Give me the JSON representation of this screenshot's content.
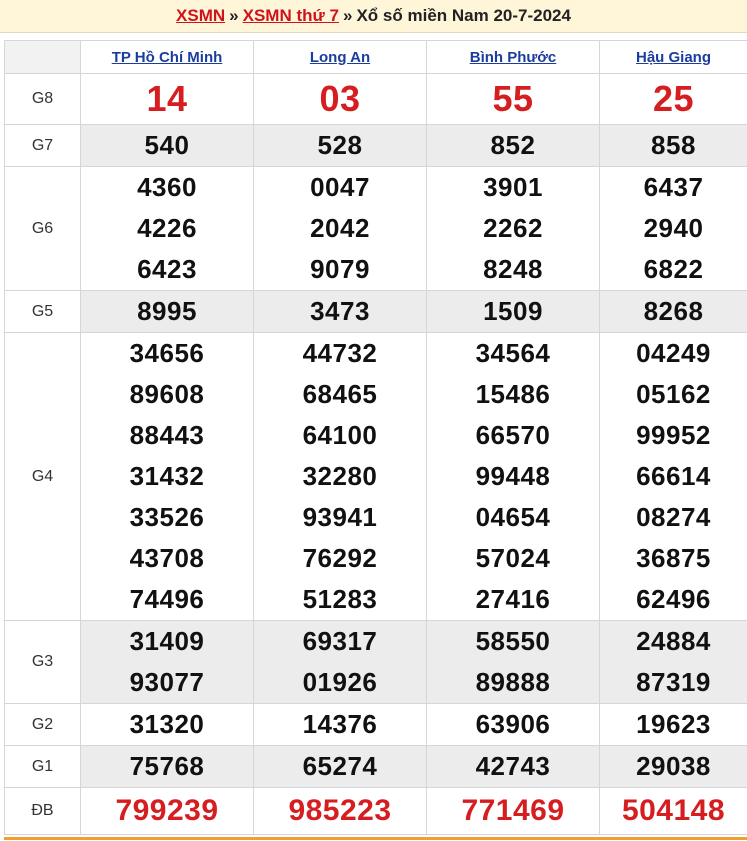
{
  "breadcrumb": {
    "home": "XSMN",
    "section": "XSMN thứ 7",
    "separator": "»",
    "current": "Xổ số miền Nam 20-7-2024"
  },
  "provinces": [
    "TP Hồ Chí Minh",
    "Long An",
    "Bình Phước",
    "Hậu Giang"
  ],
  "prizes": [
    {
      "label": "G8",
      "style": "big",
      "values": [
        [
          "14"
        ],
        [
          "03"
        ],
        [
          "55"
        ],
        [
          "25"
        ]
      ]
    },
    {
      "label": "G7",
      "style": "normal",
      "values": [
        [
          "540"
        ],
        [
          "528"
        ],
        [
          "852"
        ],
        [
          "858"
        ]
      ]
    },
    {
      "label": "G6",
      "style": "normal",
      "values": [
        [
          "4360",
          "4226",
          "6423"
        ],
        [
          "0047",
          "2042",
          "9079"
        ],
        [
          "3901",
          "2262",
          "8248"
        ],
        [
          "6437",
          "2940",
          "6822"
        ]
      ]
    },
    {
      "label": "G5",
      "style": "normal",
      "values": [
        [
          "8995"
        ],
        [
          "3473"
        ],
        [
          "1509"
        ],
        [
          "8268"
        ]
      ]
    },
    {
      "label": "G4",
      "style": "normal",
      "values": [
        [
          "34656",
          "89608",
          "88443",
          "31432",
          "33526",
          "43708",
          "74496"
        ],
        [
          "44732",
          "68465",
          "64100",
          "32280",
          "93941",
          "76292",
          "51283"
        ],
        [
          "34564",
          "15486",
          "66570",
          "99448",
          "04654",
          "57024",
          "27416"
        ],
        [
          "04249",
          "05162",
          "99952",
          "66614",
          "08274",
          "36875",
          "62496"
        ]
      ]
    },
    {
      "label": "G3",
      "style": "normal",
      "values": [
        [
          "31409",
          "93077"
        ],
        [
          "69317",
          "01926"
        ],
        [
          "58550",
          "89888"
        ],
        [
          "24884",
          "87319"
        ]
      ]
    },
    {
      "label": "G2",
      "style": "normal",
      "values": [
        [
          "31320"
        ],
        [
          "14376"
        ],
        [
          "63906"
        ],
        [
          "19623"
        ]
      ]
    },
    {
      "label": "G1",
      "style": "normal",
      "values": [
        [
          "75768"
        ],
        [
          "65274"
        ],
        [
          "42743"
        ],
        [
          "29038"
        ]
      ]
    },
    {
      "label": "ĐB",
      "style": "db",
      "values": [
        [
          "799239"
        ],
        [
          "985223"
        ],
        [
          "771469"
        ],
        [
          "504148"
        ]
      ]
    }
  ],
  "colors": {
    "accent_red": "#d61d20",
    "link_blue": "#1b3d9e",
    "header_bg": "#fff6d9",
    "row_gray": "#ececec"
  }
}
